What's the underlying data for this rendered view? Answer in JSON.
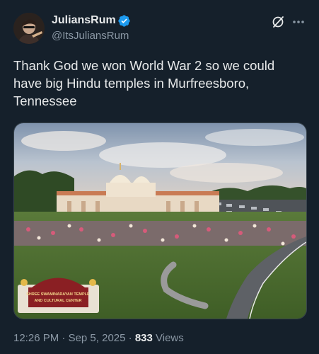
{
  "author": {
    "display_name": "JuliansRum",
    "handle": "@ItsJuliansRum",
    "verified": true,
    "verified_color": "#1d9bf0"
  },
  "tweet": {
    "text": "Thank God we won World War 2 so we could have big Hindu temples in Murfreesboro, Tennessee"
  },
  "media": {
    "kind": "photo",
    "sign_text_line1": "SHREE SWAMINARAYAN TEMPLE",
    "sign_text_line2": "AND CULTURAL CENTER"
  },
  "meta": {
    "time": "12:26 PM",
    "separator1": "·",
    "date": "Sep 5, 2025",
    "separator2": "·",
    "views_count": "833",
    "views_label": "Views"
  },
  "icons": {
    "grok": "grok-icon",
    "more": "more-icon",
    "verified": "verified-badge-icon"
  },
  "colors": {
    "background": "#15202b",
    "text_primary": "#e7e9ea",
    "text_secondary": "#8b98a5",
    "accent": "#1d9bf0"
  }
}
